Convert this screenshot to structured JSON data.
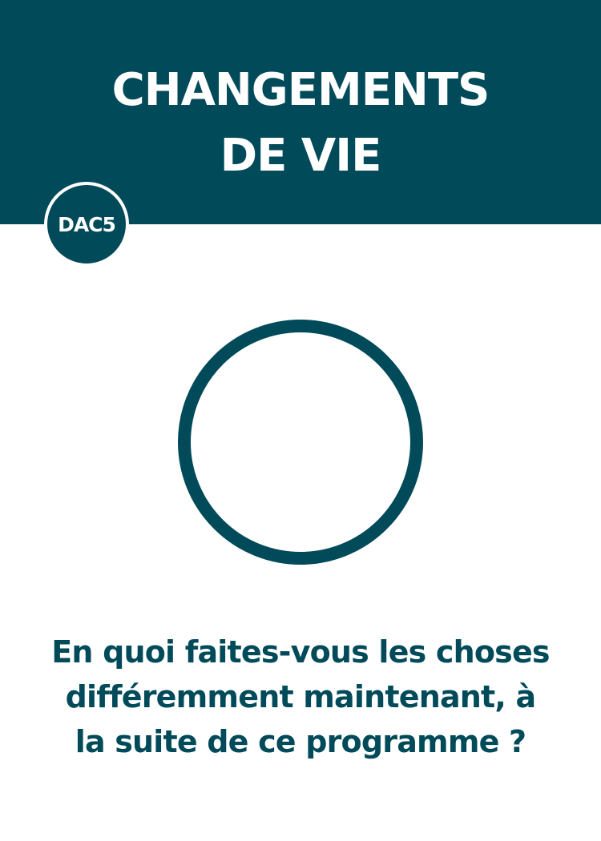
{
  "card": {
    "title_lines": [
      "CHANGEMENTS",
      "DE VIE"
    ],
    "badge_code": "DAC5",
    "question_lines": [
      "En quoi faites-vous les choses",
      "différemment maintenant, à",
      "la suite de ce programme ?"
    ]
  },
  "colors": {
    "primary": "#004a59",
    "background": "#ffffff"
  },
  "icons": {
    "center_graphic": "circle-outline-icon"
  }
}
